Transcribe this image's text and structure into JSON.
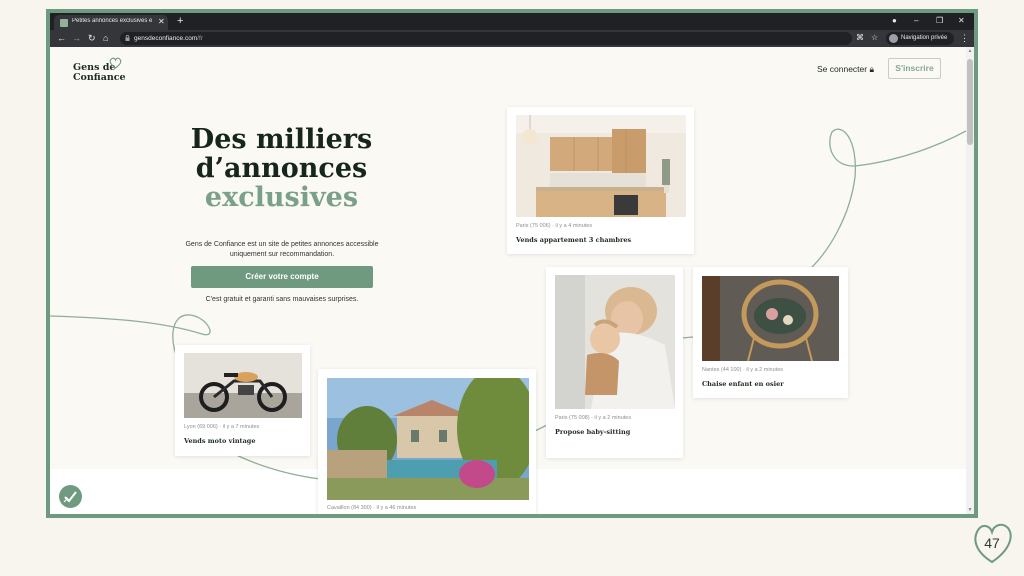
{
  "browser": {
    "tab_title": "Petites annonces exclusives et s…",
    "url_host": "gensdeconfiance.com",
    "url_path": "/fr",
    "private_label": "Navigation privée"
  },
  "header": {
    "logo_line1": "Gens de",
    "logo_line2": "Confiance",
    "login_label": "Se connecter",
    "signup_label": "S'inscrire"
  },
  "hero": {
    "title_line1": "Des milliers",
    "title_line2": "d’annonces",
    "title_accent": "exclusives",
    "description_line1": "Gens de Confiance est un site de petites annonces accessible",
    "description_line2": "uniquement sur recommandation.",
    "cta_label": "Créer votre compte",
    "note": "C'est gratuit et garanti sans mauvaises surprises."
  },
  "listings": [
    {
      "meta": "Paris (75 006) · il y a 4 minutes",
      "title": "Vends appartement 3 chambres"
    },
    {
      "meta": "Paris (75 008) · il y a 2 minutes",
      "title": "Propose baby-sitting"
    },
    {
      "meta": "Nantes (44 100) · il y a 2 minutes",
      "title": "Chaise enfant en osier"
    },
    {
      "meta": "Lyon (69 006) · il y a 7 minutes",
      "title": "Vends moto vintage"
    },
    {
      "meta": "Cavaillon (84 300) · il y a 46 minutes",
      "title": ""
    }
  ],
  "slide": {
    "number": "47"
  },
  "colors": {
    "brand_green": "#6f9a80",
    "frame_green": "#6e9a80",
    "heading": "#17261c",
    "accent": "#7aa08a"
  }
}
